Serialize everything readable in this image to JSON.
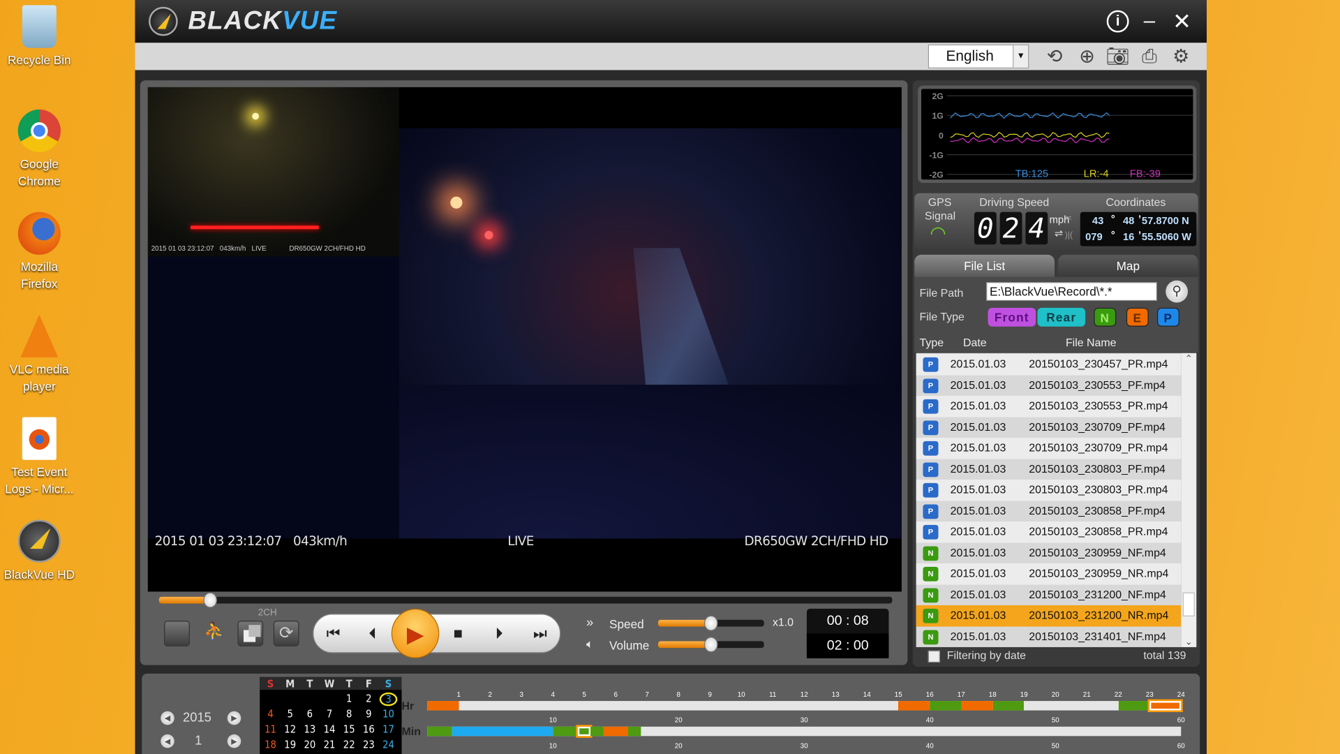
{
  "desktop": {
    "icons": [
      {
        "label": "Recycle Bin",
        "icon": "recycle-bin-icon"
      },
      {
        "label": "Google Chrome",
        "icon": "chrome-icon"
      },
      {
        "label": "Mozilla Firefox",
        "icon": "firefox-icon"
      },
      {
        "label": "VLC media player",
        "icon": "vlc-icon"
      },
      {
        "label": "Test Event Logs - Micr...",
        "icon": "firefox-document-icon"
      },
      {
        "label": "BlackVue HD",
        "icon": "blackvue-icon"
      }
    ]
  },
  "app": {
    "brand_a": "BLACK",
    "brand_b": "VUE",
    "accent": "#f4a51c"
  },
  "toolbar": {
    "language": "English"
  },
  "video": {
    "timestamp": "2015 01 03  23:12:07",
    "speed": "043km/h",
    "mode": "LIVE",
    "model": "DR650GW 2CH/FHD HD",
    "rear_overlay": "2015 01 03 23:12:07   043km/h   LIVE            DR650GW 2CH/FHD HD"
  },
  "player": {
    "channel_label": "2CH",
    "speed_label": "Speed",
    "speed_value": "x1.0",
    "volume_label": "Volume",
    "current_time": "00 : 08",
    "total_time": "02 : 00",
    "progress_percent": 7,
    "speed_level_percent": 50,
    "volume_level_percent": 50
  },
  "gsensor": {
    "axis": [
      "2G",
      "1G",
      "0",
      "-1G",
      "-2G"
    ],
    "tb": "TB:125",
    "lr": "LR:-4",
    "fb": "FB:-39",
    "colors": {
      "tb": "#3a8ee0",
      "lr": "#d8d020",
      "fb": "#d030c0"
    }
  },
  "gps": {
    "signal_label_1": "GPS",
    "signal_label_2": "Signal",
    "speed_title": "Driving Speed",
    "digits": [
      "0",
      "2",
      "4"
    ],
    "unit": "mph",
    "coords_title": "Coordinates",
    "lat_deg": "43",
    "lat_min": "48",
    "lat_sec": "57.8700 N",
    "lon_deg": "079",
    "lon_min": "16",
    "lon_sec": "55.5060 W"
  },
  "tabs": {
    "file_list": "File List",
    "map": "Map"
  },
  "filter": {
    "path_label": "File Path",
    "path_value": "E:\\BlackVue\\Record\\*.*",
    "type_label": "File Type",
    "front": "Front",
    "rear": "Rear",
    "n": "N",
    "e": "E",
    "p": "P"
  },
  "list": {
    "col_type": "Type",
    "col_date": "Date",
    "col_name": "File Name",
    "filter_by_date": "Filtering by date",
    "total": "total 139",
    "rows": [
      {
        "type": "P",
        "date": "2015.01.03",
        "name": "20150103_230457_PR.mp4"
      },
      {
        "type": "P",
        "date": "2015.01.03",
        "name": "20150103_230553_PF.mp4"
      },
      {
        "type": "P",
        "date": "2015.01.03",
        "name": "20150103_230553_PR.mp4"
      },
      {
        "type": "P",
        "date": "2015.01.03",
        "name": "20150103_230709_PF.mp4"
      },
      {
        "type": "P",
        "date": "2015.01.03",
        "name": "20150103_230709_PR.mp4"
      },
      {
        "type": "P",
        "date": "2015.01.03",
        "name": "20150103_230803_PF.mp4"
      },
      {
        "type": "P",
        "date": "2015.01.03",
        "name": "20150103_230803_PR.mp4"
      },
      {
        "type": "P",
        "date": "2015.01.03",
        "name": "20150103_230858_PF.mp4"
      },
      {
        "type": "P",
        "date": "2015.01.03",
        "name": "20150103_230858_PR.mp4"
      },
      {
        "type": "N",
        "date": "2015.01.03",
        "name": "20150103_230959_NF.mp4"
      },
      {
        "type": "N",
        "date": "2015.01.03",
        "name": "20150103_230959_NR.mp4"
      },
      {
        "type": "N",
        "date": "2015.01.03",
        "name": "20150103_231200_NF.mp4"
      },
      {
        "type": "N",
        "date": "2015.01.03",
        "name": "20150103_231200_NR.mp4",
        "selected": true
      },
      {
        "type": "N",
        "date": "2015.01.03",
        "name": "20150103_231401_NF.mp4"
      }
    ]
  },
  "calendar": {
    "year": "2015",
    "month": "1",
    "weekdays": [
      "S",
      "M",
      "T",
      "W",
      "T",
      "F",
      "S"
    ],
    "weeks": [
      [
        "",
        "",
        "",
        "",
        "1",
        "2",
        "3"
      ],
      [
        "4",
        "5",
        "6",
        "7",
        "8",
        "9",
        "10"
      ],
      [
        "11",
        "12",
        "13",
        "14",
        "15",
        "16",
        "17"
      ],
      [
        "18",
        "19",
        "20",
        "21",
        "22",
        "23",
        "24"
      ]
    ],
    "selected_day": "3"
  },
  "timeline": {
    "hr_label": "Hr",
    "min_label": "Min",
    "hr_ticks": [
      "1",
      "2",
      "3",
      "4",
      "5",
      "6",
      "7",
      "8",
      "9",
      "10",
      "11",
      "12",
      "13",
      "14",
      "15",
      "16",
      "17",
      "18",
      "19",
      "20",
      "21",
      "22",
      "23",
      "24"
    ],
    "min_ticks": [
      "10",
      "20",
      "30",
      "40",
      "50",
      "60"
    ],
    "hr_segments": [
      {
        "from": 0,
        "to": 1,
        "kind": "event"
      },
      {
        "from": 15,
        "to": 16,
        "kind": "event"
      },
      {
        "from": 16,
        "to": 17,
        "kind": "normal"
      },
      {
        "from": 17,
        "to": 18,
        "kind": "event"
      },
      {
        "from": 18,
        "to": 19,
        "kind": "normal"
      },
      {
        "from": 22,
        "to": 23,
        "kind": "normal"
      },
      {
        "from": 23,
        "to": 24,
        "kind": "event",
        "selected": true
      }
    ],
    "min_segments": [
      {
        "from": 0,
        "to": 2,
        "kind": "normal"
      },
      {
        "from": 2,
        "to": 10,
        "kind": "parking"
      },
      {
        "from": 10,
        "to": 12,
        "kind": "normal"
      },
      {
        "from": 12,
        "to": 13,
        "kind": "normal",
        "selected": true
      },
      {
        "from": 13,
        "to": 14,
        "kind": "normal"
      },
      {
        "from": 14,
        "to": 16,
        "kind": "event"
      },
      {
        "from": 16,
        "to": 17,
        "kind": "normal"
      }
    ],
    "colors": {
      "normal": "#4e9a10",
      "event": "#f06a00",
      "parking": "#1eaaf0"
    }
  }
}
